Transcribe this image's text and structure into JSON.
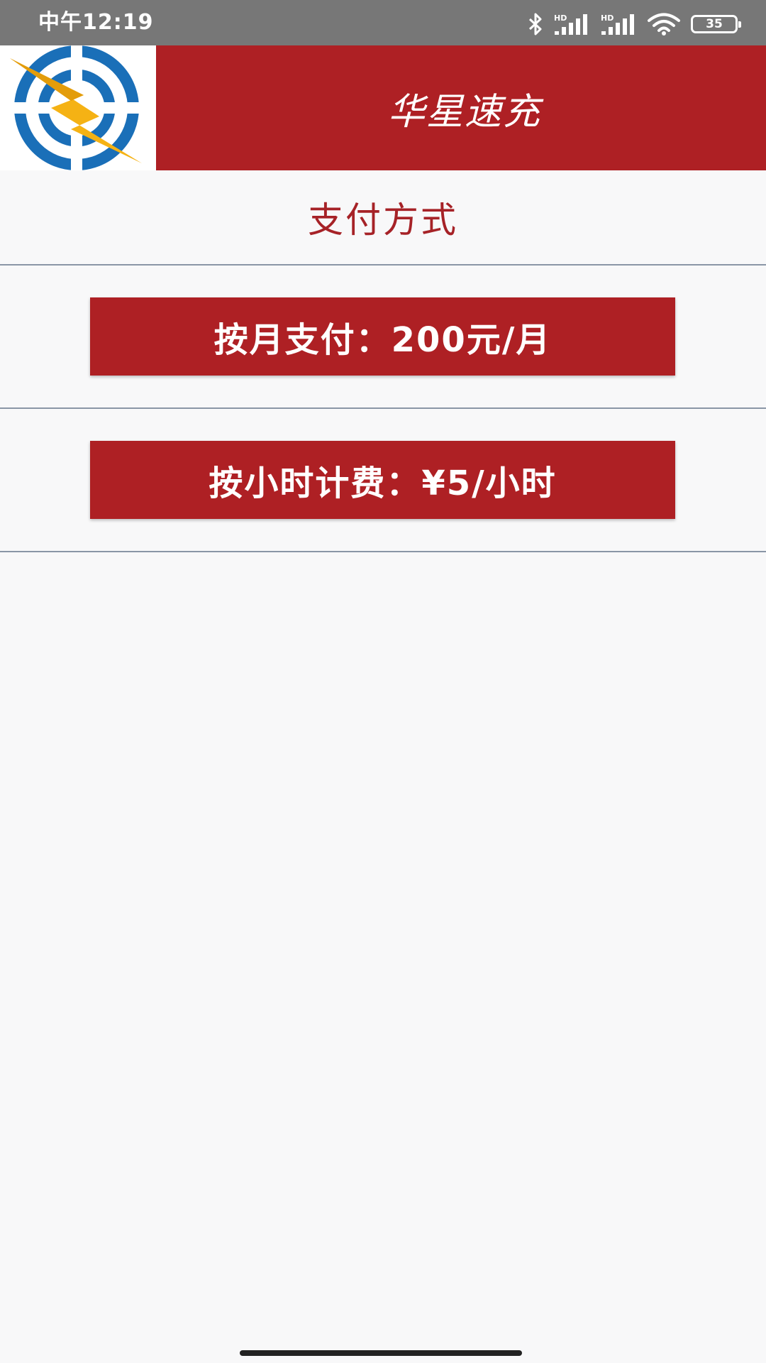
{
  "status_bar": {
    "time": "中午12:19",
    "battery_level": "35",
    "icons": [
      "bluetooth-icon",
      "signal-hd-icon",
      "signal-hd-icon",
      "wifi-icon",
      "battery-icon"
    ]
  },
  "header": {
    "logo": "lightning-charge-logo",
    "title": "华星速充"
  },
  "section": {
    "title": "支付方式"
  },
  "payment_options": [
    {
      "label": "按月支付：200元/月"
    },
    {
      "label": "按小时计费：¥5/小时"
    }
  ],
  "colors": {
    "brand_red": "#ae2024",
    "title_text_red": "#a62227",
    "logo_blue": "#1a6fb8",
    "logo_yellow": "#f5b214",
    "status_bar_gray": "#777777",
    "background": "#f8f8f9"
  }
}
